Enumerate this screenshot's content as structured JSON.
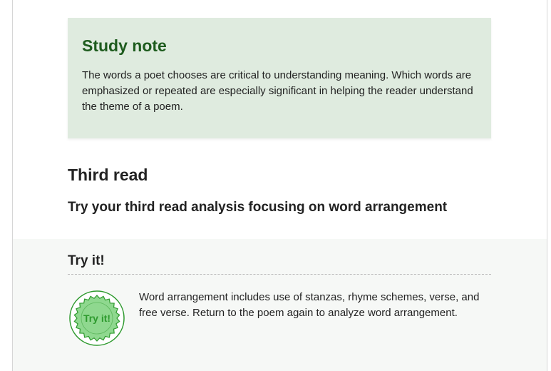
{
  "study_note": {
    "heading": "Study note",
    "text": "The words a poet chooses are critical to understanding meaning. Which words are emphasized or repeated are especially significant in helping the reader understand the theme of a poem."
  },
  "third_read": {
    "heading": "Third read",
    "subheading": "Try your third read analysis focusing on word arrangement"
  },
  "try_it": {
    "heading": "Try it!",
    "badge_label": "Try it!",
    "badge_icon": "try-it-seal-icon",
    "text": "Word arrangement includes use of stanzas, rhyme schemes, verse, and free verse. Return to the poem again to analyze word arrangement."
  },
  "colors": {
    "note_background": "#dfebdf",
    "note_heading": "#1e5c1e",
    "badge_green": "#2e9a2e",
    "badge_fill": "#8fd88f",
    "panel_background": "#f6f8f6"
  }
}
